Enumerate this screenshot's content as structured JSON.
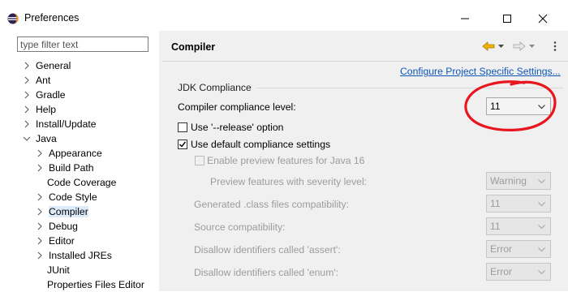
{
  "window": {
    "title": "Preferences"
  },
  "filter": {
    "placeholder": "type filter text"
  },
  "tree": {
    "general": "General",
    "ant": "Ant",
    "gradle": "Gradle",
    "help": "Help",
    "install_update": "Install/Update",
    "java": "Java",
    "appearance": "Appearance",
    "build_path": "Build Path",
    "code_coverage": "Code Coverage",
    "code_style": "Code Style",
    "compiler": "Compiler",
    "debug": "Debug",
    "editor": "Editor",
    "installed_jres": "Installed JREs",
    "junit": "JUnit",
    "properties_files_editor": "Properties Files Editor"
  },
  "page": {
    "title": "Compiler",
    "config_link": "Configure Project Specific Settings...",
    "jdk_group": "JDK Compliance",
    "compliance_label": "Compiler compliance level:",
    "compliance_value": "11",
    "use_release": "Use '--release' option",
    "use_release_checked": false,
    "use_default": "Use default compliance settings",
    "use_default_checked": true,
    "enable_preview": "Enable preview features for Java 16",
    "enable_preview_checked": false,
    "preview_severity_label": "Preview features with severity level:",
    "preview_severity_value": "Warning",
    "generated_label": "Generated .class files compatibility:",
    "generated_value": "11",
    "source_label": "Source compatibility:",
    "source_value": "11",
    "assert_label": "Disallow identifiers called 'assert':",
    "assert_value": "Error",
    "enum_label": "Disallow identifiers called 'enum':",
    "enum_value": "Error"
  },
  "colors": {
    "link": "#0d56b8",
    "annotation": "#e8161e",
    "selection": "#dcecfb",
    "nav_back": "#f2b400"
  },
  "icons": {
    "app": "eclipse-icon",
    "back": "back-arrow-icon",
    "forward": "forward-arrow-icon",
    "dropdown": "chevron-down-icon",
    "expand": "chevron-right-icon",
    "collapse": "chevron-down-icon"
  }
}
